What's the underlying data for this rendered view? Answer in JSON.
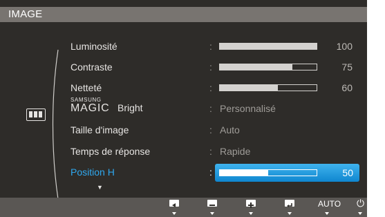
{
  "osd": {
    "title": "IMAGE",
    "menu_items": [
      {
        "label": "Luminosité",
        "value": "100",
        "level_percent": 100
      },
      {
        "label": "Contraste",
        "value": "75",
        "level_percent": 75
      },
      {
        "label": "Netteté",
        "value": "60",
        "level_percent": 60
      },
      {
        "label_small": "SAMSUNG",
        "label_main": "MAGIC",
        "label_suffix": "Bright",
        "value": "Personnalisé"
      },
      {
        "label": "Taille d'image",
        "value": "Auto"
      },
      {
        "label": "Temps de réponse",
        "value": "Rapide"
      },
      {
        "label": "Position H",
        "value": "50",
        "level_percent": 50,
        "selected": true
      }
    ],
    "separator": ":",
    "more_indicator": "▼",
    "buttons": {
      "left": "left-arrow-icon",
      "minus": "minus-icon",
      "plus": "plus-icon",
      "enter": "enter-icon",
      "auto": "AUTO",
      "power": "⏻"
    },
    "colors": {
      "selected_text": "#2ea8ef",
      "highlight_top": "#3fb3ee",
      "highlight_bottom": "#0f86cf"
    }
  }
}
